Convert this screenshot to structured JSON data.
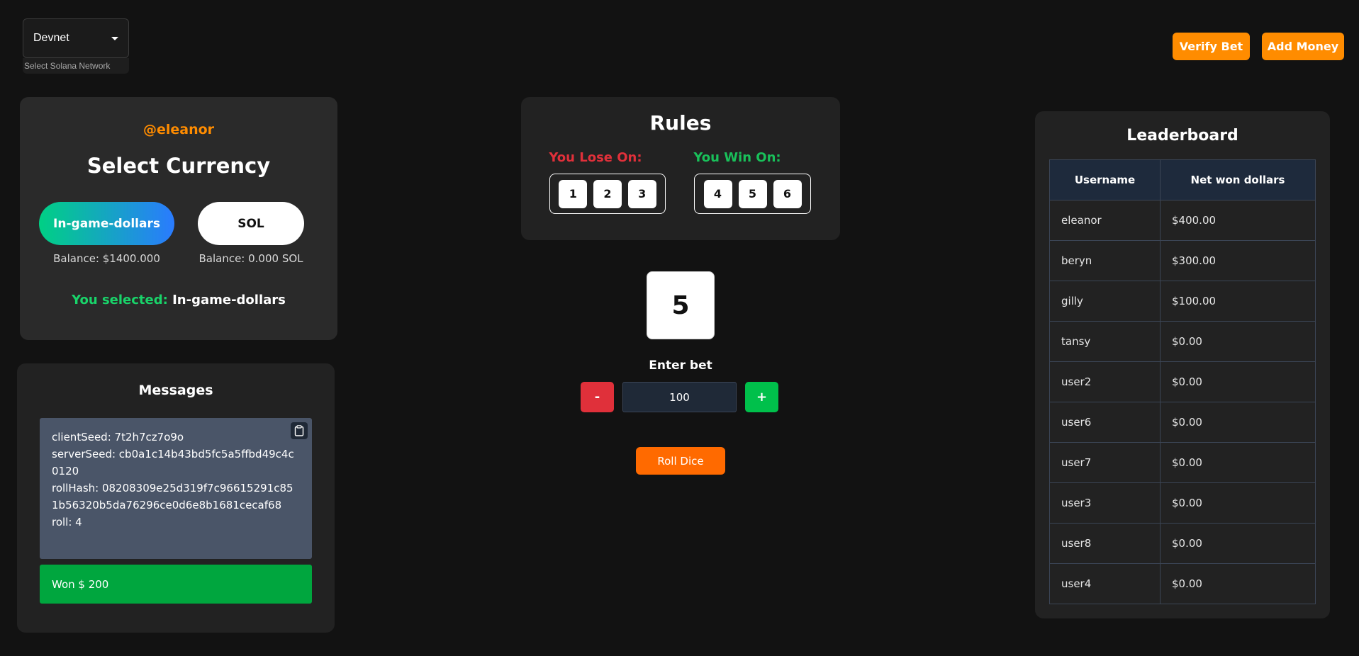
{
  "network": {
    "selected": "Devnet",
    "helper": "Select Solana Network"
  },
  "header": {
    "verify_label": "Verify Bet",
    "add_money_label": "Add Money"
  },
  "currency": {
    "username": "@eleanor",
    "title": "Select Currency",
    "igd_label": "In-game-dollars",
    "sol_label": "SOL",
    "igd_balance": "Balance: $1400.000",
    "sol_balance": "Balance: 0.000 SOL",
    "selected_label": "You selected:",
    "selected_value": "In-game-dollars"
  },
  "messages": {
    "title": "Messages",
    "lines": [
      "clientSeed: 7t2h7cz7o9o",
      "serverSeed: cb0a1c14b43bd5fc5a5ffbd49c4c0120",
      "rollHash: 08208309e25d319f7c96615291c851b56320b5da76296ce0d6e8b1681cecaf68",
      "roll: 4"
    ],
    "result": "Won $ 200"
  },
  "rules": {
    "title": "Rules",
    "lose_label": "You Lose On:",
    "win_label": "You Win On:",
    "lose_numbers": [
      "1",
      "2",
      "3"
    ],
    "win_numbers": [
      "4",
      "5",
      "6"
    ]
  },
  "game": {
    "die_value": "5",
    "enter_bet_label": "Enter bet",
    "minus_label": "-",
    "plus_label": "+",
    "bet_value": "100",
    "roll_label": "Roll Dice"
  },
  "leaderboard": {
    "title": "Leaderboard",
    "columns": [
      "Username",
      "Net won dollars"
    ],
    "rows": [
      [
        "eleanor",
        "$400.00"
      ],
      [
        "beryn",
        "$300.00"
      ],
      [
        "gilly",
        "$100.00"
      ],
      [
        "tansy",
        "$0.00"
      ],
      [
        "user2",
        "$0.00"
      ],
      [
        "user6",
        "$0.00"
      ],
      [
        "user7",
        "$0.00"
      ],
      [
        "user3",
        "$0.00"
      ],
      [
        "user8",
        "$0.00"
      ],
      [
        "user4",
        "$0.00"
      ]
    ]
  },
  "colors": {
    "accent": "#ff8c00",
    "win": "#00a63e",
    "lose": "#e0303a",
    "background": "#121212"
  },
  "icons": {
    "copy": "clipboard-icon",
    "dropdown": "caret-down-icon"
  }
}
